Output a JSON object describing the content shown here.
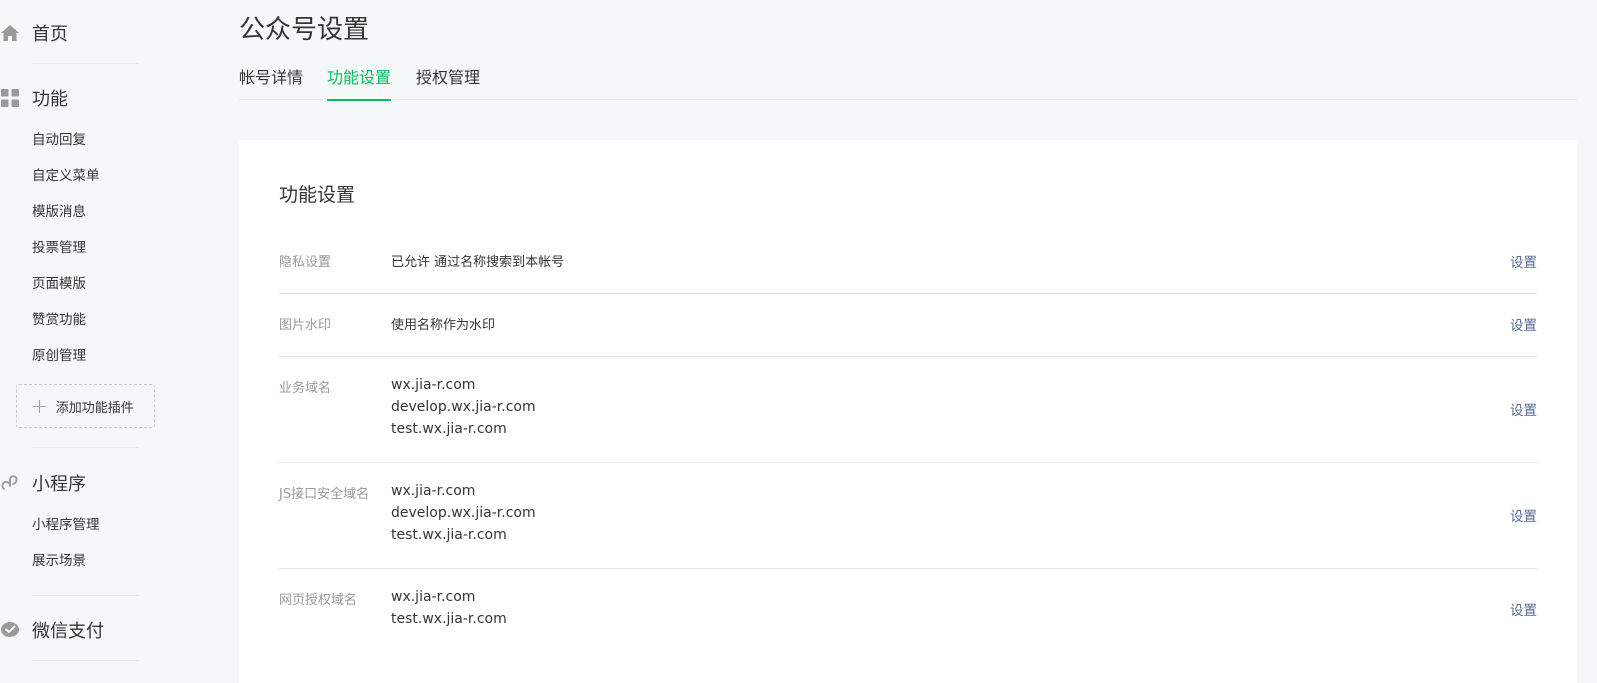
{
  "sidebar": {
    "home": {
      "label": "首页",
      "icon": "home-icon"
    },
    "features": {
      "label": "功能",
      "icon": "grid-icon",
      "items": [
        {
          "label": "自动回复"
        },
        {
          "label": "自定义菜单"
        },
        {
          "label": "模版消息"
        },
        {
          "label": "投票管理"
        },
        {
          "label": "页面模版"
        },
        {
          "label": "赞赏功能"
        },
        {
          "label": "原创管理"
        }
      ],
      "add_plugin_label": "添加功能插件"
    },
    "miniprogram": {
      "label": "小程序",
      "icon": "link-icon",
      "items": [
        {
          "label": "小程序管理"
        },
        {
          "label": "展示场景"
        }
      ]
    },
    "pay": {
      "label": "微信支付",
      "icon": "wechat-pay-icon"
    }
  },
  "header": {
    "title": "公众号设置",
    "tabs": [
      {
        "label": "帐号详情",
        "active": false
      },
      {
        "label": "功能设置",
        "active": true
      },
      {
        "label": "授权管理",
        "active": false
      }
    ]
  },
  "card": {
    "title": "功能设置",
    "rows": [
      {
        "label": "隐私设置",
        "values": [
          "已允许 通过名称搜索到本帐号"
        ],
        "action": "设置"
      },
      {
        "label": "图片水印",
        "values": [
          "使用名称作为水印"
        ],
        "action": "设置"
      },
      {
        "label": "业务域名",
        "values": [
          "wx.jia-r.com",
          "develop.wx.jia-r.com",
          "test.wx.jia-r.com"
        ],
        "action": "设置"
      },
      {
        "label": "JS接口安全域名",
        "values": [
          "wx.jia-r.com",
          "develop.wx.jia-r.com",
          "test.wx.jia-r.com"
        ],
        "action": "设置"
      },
      {
        "label": "网页授权域名",
        "values": [
          "wx.jia-r.com",
          "test.wx.jia-r.com"
        ],
        "action": "设置"
      }
    ]
  },
  "colors": {
    "accent_green": "#07c160",
    "link_blue": "#576b95",
    "background": "#f6f7f9"
  }
}
